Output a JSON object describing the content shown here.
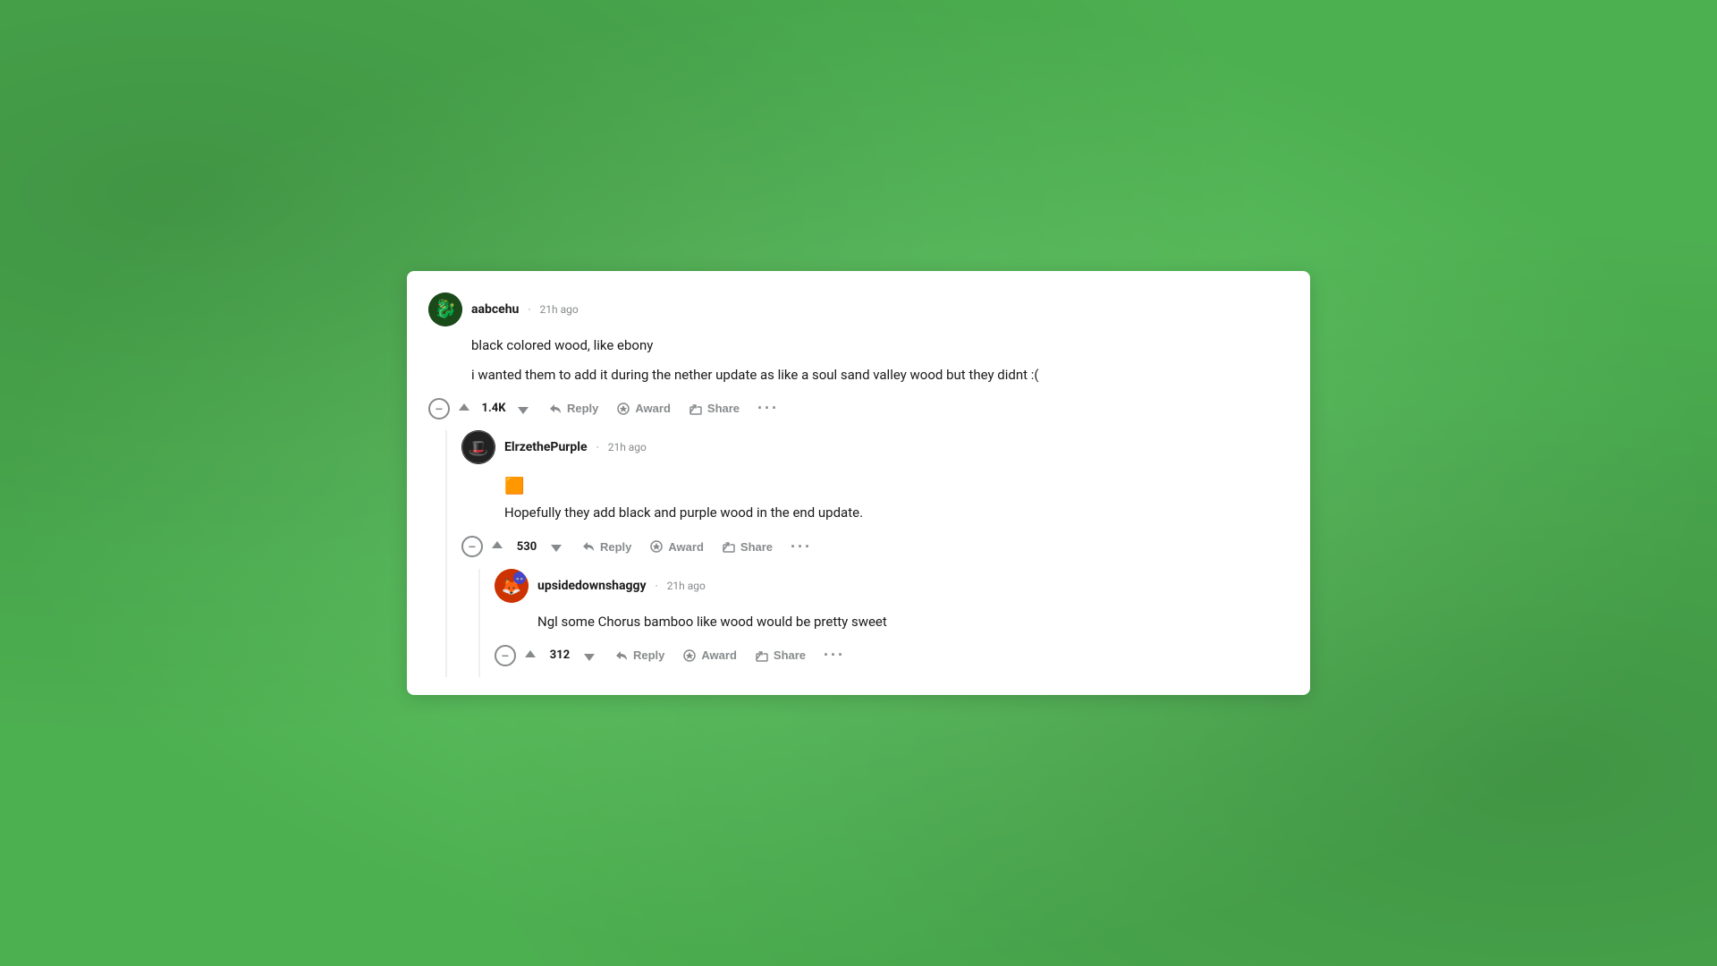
{
  "background": {
    "color": "#4caf50"
  },
  "comments": [
    {
      "id": "comment-1",
      "username": "aabcehu",
      "timestamp": "21h ago",
      "avatar_emoji": "🐉",
      "avatar_bg": "#1a5c1a",
      "lines": [
        "black colored wood, like ebony",
        "i wanted them to add it during the nether update as like a soul sand valley wood but they didnt :("
      ],
      "score": "1.4K",
      "actions": [
        "Reply",
        "Award",
        "Share"
      ],
      "emoji_badge": null,
      "replies": [
        {
          "id": "comment-2",
          "username": "ElrzethePurple",
          "timestamp": "21h ago",
          "avatar_emoji": "🎩",
          "avatar_bg": "#222222",
          "lines": [
            "Hopefully they add black and purple wood in the end update."
          ],
          "score": "530",
          "actions": [
            "Reply",
            "Award",
            "Share"
          ],
          "emoji_badge": "🟧",
          "replies": [
            {
              "id": "comment-3",
              "username": "upsidedownshaggy",
              "timestamp": "21h ago",
              "avatar_emoji": "🦊",
              "avatar_bg": "#cc3300",
              "lines": [
                "Ngl some Chorus bamboo like wood would be pretty sweet"
              ],
              "score": "312",
              "actions": [
                "Reply",
                "Award",
                "Share"
              ],
              "emoji_badge": null,
              "replies": []
            }
          ]
        }
      ]
    }
  ],
  "labels": {
    "reply": "Reply",
    "award": "Award",
    "share": "Share",
    "more": "···"
  }
}
